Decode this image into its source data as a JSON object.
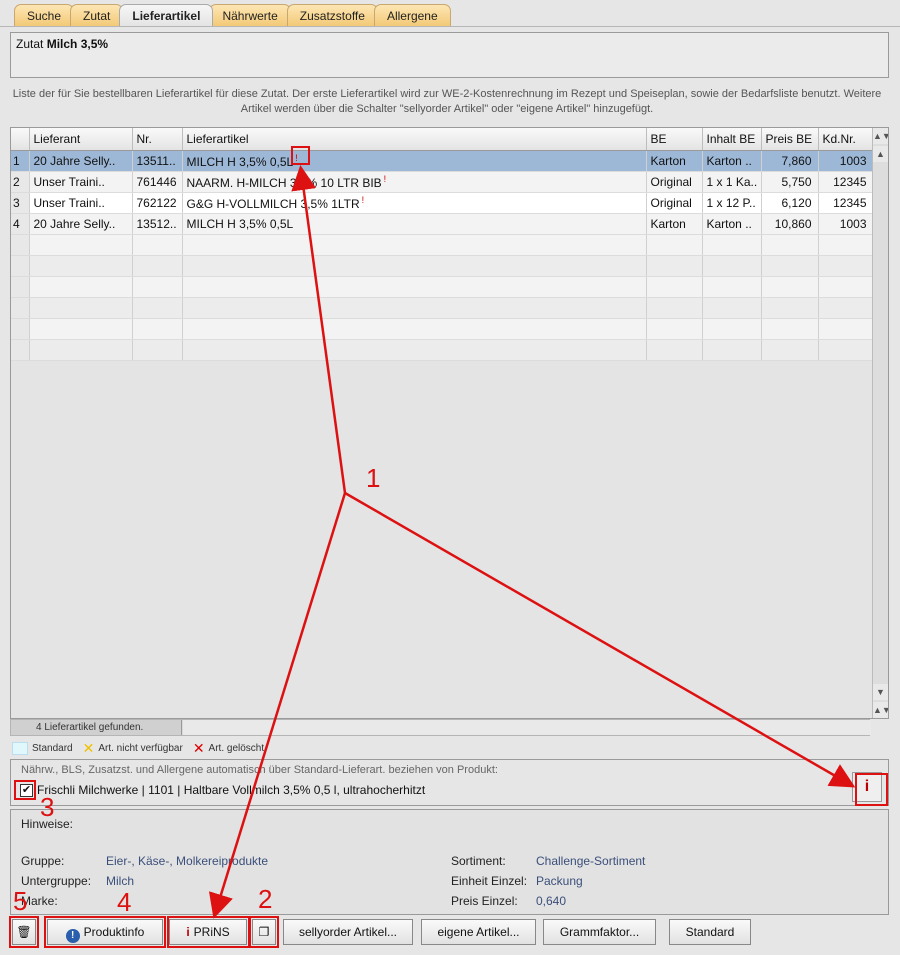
{
  "tabs": [
    "Suche",
    "Zutat",
    "Lieferartikel",
    "Nährwerte",
    "Zusatzstoffe",
    "Allergene"
  ],
  "header": {
    "label": "Zutat",
    "value": "Milch 3,5%"
  },
  "description_line1": "Liste der für Sie bestellbaren Lieferartikel für diese Zutat. Der erste Lieferartikel wird zur WE-2-Kostenrechnung im Rezept und Speiseplan, sowie der Bedarfsliste benutzt. Weitere",
  "description_line2": "Artikel werden über die Schalter \"sellyorder Artikel\" oder \"eigene Artikel\" hinzugefügt.",
  "table": {
    "headers": [
      "",
      "Lieferant",
      "Nr.",
      "Lieferartikel",
      "BE",
      "Inhalt BE",
      "Preis BE",
      "Kd.Nr."
    ],
    "rows": [
      {
        "idx": "1",
        "lieferant": "20 Jahre Selly..",
        "nr": "13511..",
        "artikel": "MILCH H 3,5% 0,5L",
        "be": "Karton",
        "inhalt": "Karton ..",
        "preis": "7,860",
        "kdnr": "1003",
        "selected": true
      },
      {
        "idx": "2",
        "lieferant": "Unser Traini..",
        "nr": "761446",
        "artikel": "NAARM. H-MILCH 3,5% 10 LTR BIB",
        "be": "Original",
        "inhalt": "1 x 1 Ka..",
        "preis": "5,750",
        "kdnr": "12345"
      },
      {
        "idx": "3",
        "lieferant": "Unser Traini..",
        "nr": "762122",
        "artikel": "G&G H-VOLLMILCH 3,5% 1LTR",
        "be": "Original",
        "inhalt": "1 x 12 P..",
        "preis": "6,120",
        "kdnr": "12345"
      },
      {
        "idx": "4",
        "lieferant": "20 Jahre Selly..",
        "nr": "13512..",
        "artikel": "MILCH H 3,5% 0,5L",
        "be": "Karton",
        "inhalt": "Karton ..",
        "preis": "10,860",
        "kdnr": "1003"
      }
    ],
    "found_label": "4  Lieferartikel gefunden."
  },
  "legend": {
    "standard": "Standard",
    "not_available": "Art. nicht verfügbar",
    "deleted": "Art. gelöscht"
  },
  "auto": {
    "title": "Nährw., BLS, Zusatzst. und Allergene automatisch über Standard-Lieferart. beziehen von Produkt:",
    "product": "Frischli Milchwerke | 1101 | Haltbare Vollmilch 3,5% 0,5 l, ultrahocherhitzt",
    "checked": true
  },
  "details": {
    "hinweise": "Hinweise:",
    "gruppe_label": "Gruppe:",
    "gruppe": "Eier-, Käse-, Molkereiprodukte",
    "untergruppe_label": "Untergruppe:",
    "untergruppe": "Milch",
    "marke_label": "Marke:",
    "sortiment_label": "Sortiment:",
    "sortiment": "Challenge-Sortiment",
    "einheit_label": "Einheit Einzel:",
    "einheit": "Packung",
    "preis_label": "Preis Einzel:",
    "preis": "0,640"
  },
  "buttons": {
    "produktinfo": "Produktinfo",
    "prins": "PRiNS",
    "sellyorder": "sellyorder Artikel...",
    "eigene": "eigene Artikel...",
    "grammfaktor": "Grammfaktor...",
    "standard": "Standard"
  },
  "annotations": {
    "n1": "1",
    "n2": "2",
    "n3": "3",
    "n4": "4",
    "n5": "5"
  },
  "colors": {
    "annotation": "#d11111",
    "selected_row": "#9db8d6",
    "tab_orange": "#f3c977"
  }
}
